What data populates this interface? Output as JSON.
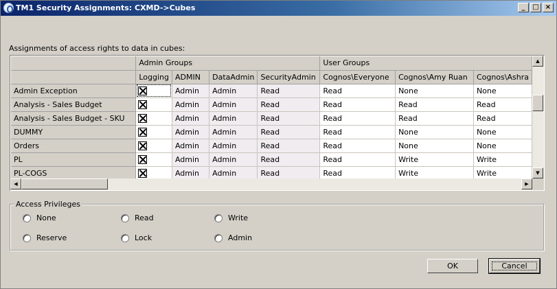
{
  "window": {
    "title": "TM1 Security Assignments:  CXMD->Cubes"
  },
  "caption": "Assignments of access rights to data in cubes:",
  "grid": {
    "group_headers": {
      "admin": "Admin Groups",
      "user": "User Groups"
    },
    "columns": [
      "Logging",
      "ADMIN",
      "DataAdmin",
      "SecurityAdmin",
      "Cognos\\Everyone",
      "Cognos\\Amy Ruan",
      "Cognos\\Ashra"
    ],
    "rows": [
      {
        "name": "Admin Exception",
        "cells": [
          "Admin",
          "Admin",
          "Read",
          "Read",
          "None",
          "None"
        ]
      },
      {
        "name": "Analysis - Sales Budget",
        "cells": [
          "Admin",
          "Admin",
          "Read",
          "Read",
          "Read",
          "Read"
        ]
      },
      {
        "name": "Analysis - Sales Budget - SKU",
        "cells": [
          "Admin",
          "Admin",
          "Read",
          "Read",
          "Read",
          "Read"
        ]
      },
      {
        "name": "DUMMY",
        "cells": [
          "Admin",
          "Admin",
          "Read",
          "Read",
          "None",
          "None"
        ]
      },
      {
        "name": "Orders",
        "cells": [
          "Admin",
          "Admin",
          "Read",
          "Read",
          "None",
          "None"
        ]
      },
      {
        "name": "PL",
        "cells": [
          "Admin",
          "Admin",
          "Read",
          "Read",
          "Write",
          "Write"
        ]
      },
      {
        "name": "PL-COGS",
        "cells": [
          "Admin",
          "Admin",
          "Read",
          "Read",
          "Write",
          "Write"
        ]
      }
    ]
  },
  "privileges": {
    "title": "Access Privileges",
    "options": [
      "None",
      "Read",
      "Write",
      "Reserve",
      "Lock",
      "Admin"
    ]
  },
  "buttons": {
    "ok": "OK",
    "cancel": "Cancel"
  }
}
